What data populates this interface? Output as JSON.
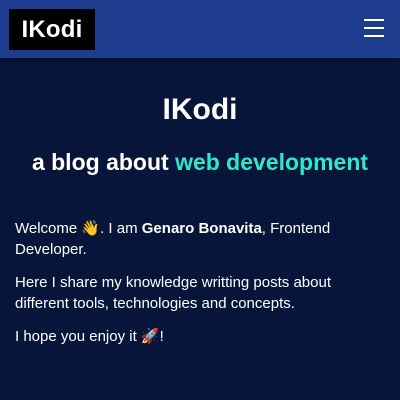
{
  "header": {
    "logo_text": "IKodi",
    "menu_icon": "hamburger-menu-icon"
  },
  "hero": {
    "title": "IKodi",
    "tagline_prefix": "a blog about ",
    "tagline_accent": "web development",
    "accent_color": "#2ee8cd"
  },
  "intro": {
    "p1_prefix": "Welcome 👋. I am ",
    "p1_name": "Genaro Bonavita",
    "p1_suffix": ", Frontend Developer.",
    "p2": "Here I share my knowledge writting posts about different tools, technologies and concepts.",
    "p3": "I hope you enjoy it 🚀!"
  },
  "colors": {
    "background": "#061539",
    "navbar": "#1f3d8e"
  }
}
